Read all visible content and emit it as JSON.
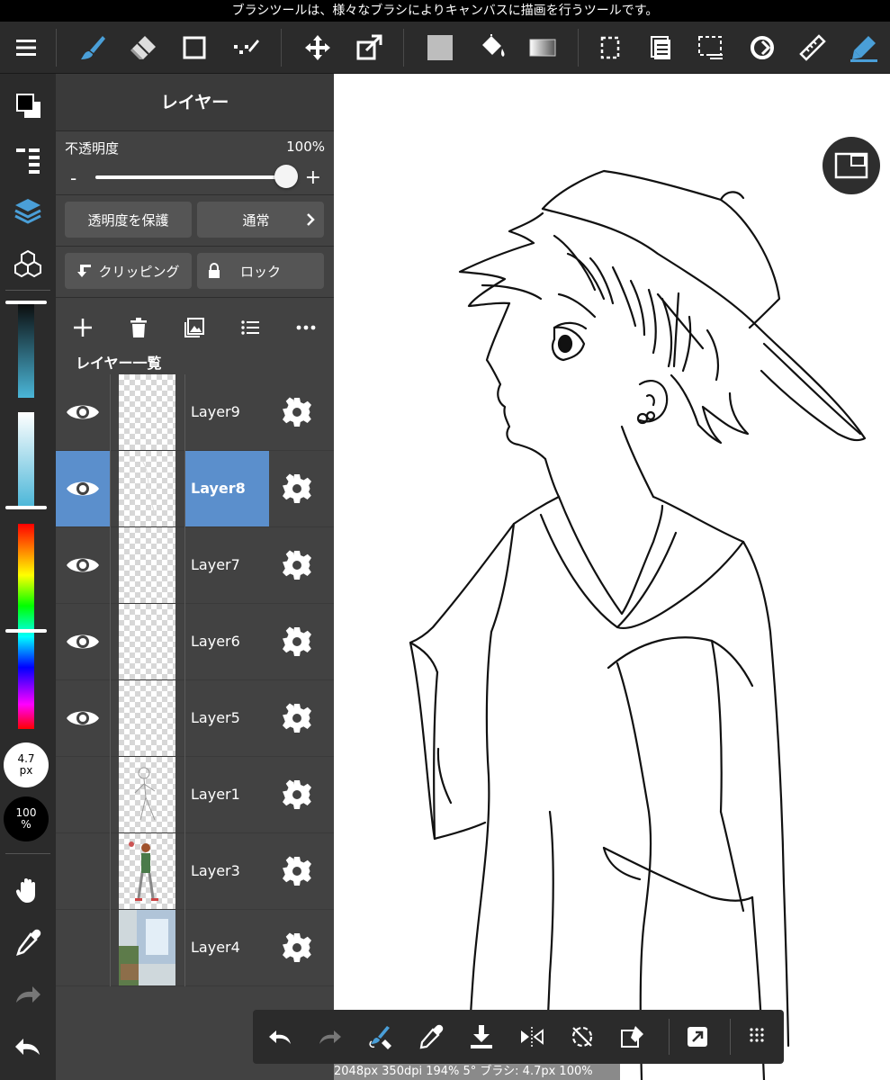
{
  "tip": "ブラシツールは、様々なブラシによりキャンバスに描画を行うツールです。",
  "panel": {
    "title": "レイヤー",
    "opacity_label": "不透明度",
    "opacity_value": "100%",
    "minus": "-",
    "plus": "+",
    "opacity_fraction": 1.0,
    "protect_label": "透明度を保護",
    "blend_label": "通常",
    "clipping_label": "クリッピング",
    "lock_label": "ロック",
    "list_title": "レイヤー一覧",
    "layers": [
      {
        "name": "Layer9",
        "visible": true,
        "selected": false
      },
      {
        "name": "Layer8",
        "visible": true,
        "selected": true
      },
      {
        "name": "Layer7",
        "visible": true,
        "selected": false
      },
      {
        "name": "Layer6",
        "visible": true,
        "selected": false
      },
      {
        "name": "Layer5",
        "visible": true,
        "selected": false
      },
      {
        "name": "Layer1",
        "visible": false,
        "selected": false
      },
      {
        "name": "Layer3",
        "visible": false,
        "selected": false
      },
      {
        "name": "Layer4",
        "visible": false,
        "selected": false
      }
    ]
  },
  "brush": {
    "size_value": "4.7",
    "size_unit": "px",
    "opacity_value": "100",
    "opacity_unit": "%"
  },
  "status": "2048px 350dpi 194% 5° ブラシ: 4.7px 100%",
  "colors": {
    "accent": "#4a9fd8",
    "selected_row": "#5b8fcc",
    "toolbar_bg": "#2b2b2b",
    "panel_bg": "#424242"
  }
}
